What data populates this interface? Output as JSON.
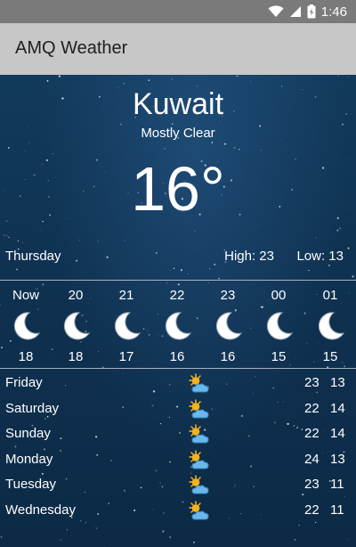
{
  "status_bar": {
    "time": "1:46",
    "icons": [
      "wifi-icon",
      "cell-signal-icon",
      "battery-icon"
    ]
  },
  "app_bar": {
    "title": "AMQ Weather"
  },
  "current": {
    "city": "Kuwait",
    "condition": "Mostly Clear",
    "temperature": "16°",
    "day": "Thursday",
    "high": "High: 23",
    "low": "Low: 13"
  },
  "hourly": [
    {
      "time": "Now",
      "temp": "18",
      "icon": "moon-icon"
    },
    {
      "time": "20",
      "temp": "18",
      "icon": "moon-icon"
    },
    {
      "time": "21",
      "temp": "17",
      "icon": "moon-icon"
    },
    {
      "time": "22",
      "temp": "16",
      "icon": "moon-icon"
    },
    {
      "time": "23",
      "temp": "16",
      "icon": "moon-icon"
    },
    {
      "time": "00",
      "temp": "15",
      "icon": "moon-icon"
    },
    {
      "time": "01",
      "temp": "15",
      "icon": "moon-icon"
    }
  ],
  "daily": [
    {
      "day": "Friday",
      "high": "23",
      "low": "13",
      "icon": "partly-cloudy-icon"
    },
    {
      "day": "Saturday",
      "high": "22",
      "low": "14",
      "icon": "partly-cloudy-icon"
    },
    {
      "day": "Sunday",
      "high": "22",
      "low": "14",
      "icon": "partly-cloudy-icon"
    },
    {
      "day": "Monday",
      "high": "24",
      "low": "13",
      "icon": "partly-cloudy-icon"
    },
    {
      "day": "Tuesday",
      "high": "23",
      "low": "11",
      "icon": "partly-cloudy-icon"
    },
    {
      "day": "Wednesday",
      "high": "22",
      "low": "11",
      "icon": "partly-cloudy-icon"
    }
  ],
  "colors": {
    "status_bar": "#7a7a7a",
    "app_bar": "#c7c7c7",
    "background": "#0f3150",
    "text": "#ffffff",
    "sun": "#f5b21b",
    "cloud": "#4aa3df"
  }
}
